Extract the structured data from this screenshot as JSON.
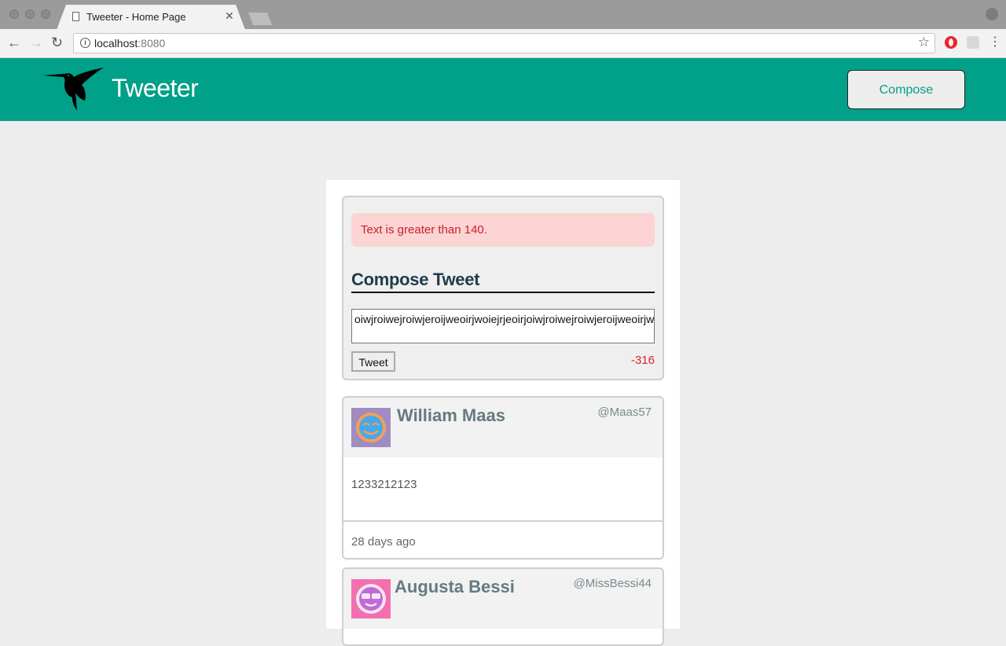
{
  "browser": {
    "tab_title": "Tweeter - Home Page",
    "url_host": "localhost",
    "url_port": ":8080"
  },
  "header": {
    "app_title": "Tweeter",
    "compose_label": "Compose"
  },
  "compose": {
    "error": "Text is greater than 140.",
    "heading": "Compose Tweet",
    "textarea_value": "oiwjroiwejroiwjeroijweoirjwoiejrjeoirjoiwjroiwejroiwjeroijweoirjwoiejr",
    "tweet_button": "Tweet",
    "counter": "-316"
  },
  "tweets": [
    {
      "name": "William Maas",
      "handle": "@Maas57",
      "content": "1233212123",
      "time": "28 days ago"
    },
    {
      "name": "Augusta Bessi",
      "handle": "@MissBessi44"
    }
  ],
  "colors": {
    "brand": "#01a088",
    "error_bg": "#fcd4d4",
    "error_text": "#c8202a",
    "counter": "#e0202a"
  }
}
